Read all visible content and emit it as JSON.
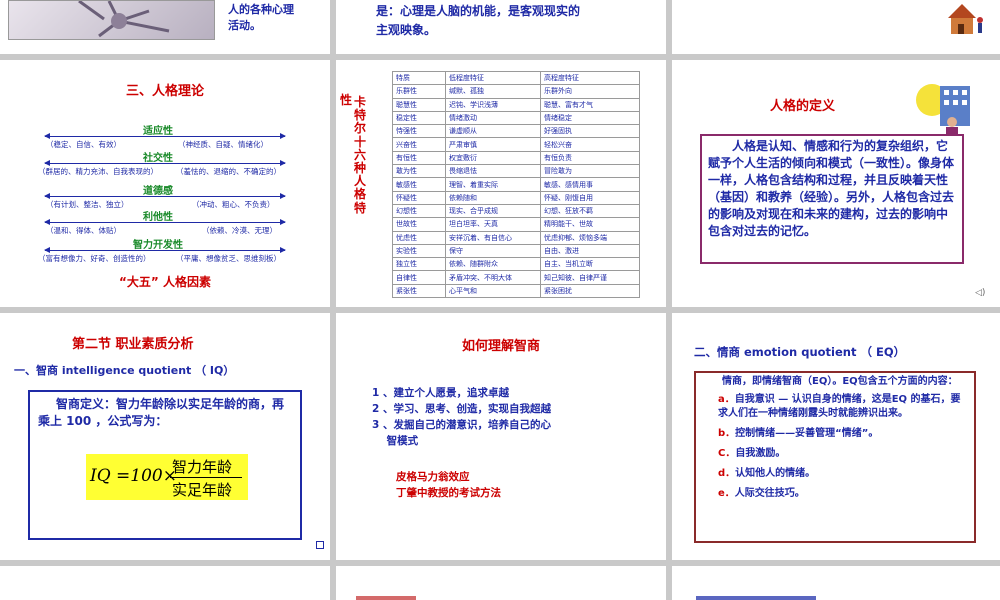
{
  "slides": {
    "s1": {
      "caption": "人的各种心理\n活动。"
    },
    "s2": {
      "text": "是：心理是人脑的机能，是客观现实的\n主观映象。"
    },
    "s4": {
      "title": "三、人格理论",
      "traits": [
        {
          "label": "适应性",
          "left": "（稳定、自信、有效）",
          "right": "（神经质、自疑、情绪化）"
        },
        {
          "label": "社交性",
          "left": "（群居的、精力充沛、自我表现的）",
          "right": "（羞怯的、退缩的、不确定的）"
        },
        {
          "label": "道德感",
          "left": "（有计划、整洁、独立）",
          "right": "（冲动、粗心、不负责）"
        },
        {
          "label": "利他性",
          "left": "（温和、得体、体贴）",
          "right": "（依赖、冷漠、无理）"
        },
        {
          "label": "智力开发性",
          "left": "（富有想像力、好奇、创造性的）",
          "right": "（平庸、想像贫乏、思维刻板）"
        }
      ],
      "footer": "“大五”  人格因素"
    },
    "s5": {
      "side_title": [
        "性",
        "卡",
        "特",
        "尔",
        "十",
        "六",
        "种",
        "人",
        "格",
        "特"
      ],
      "headers": [
        "特质",
        "低程度特征",
        "高程度特征"
      ],
      "rows": [
        [
          "乐群性",
          "缄默、孤独",
          "乐群外向"
        ],
        [
          "聪慧性",
          "迟钝、学识浅薄",
          "聪慧、富有才气"
        ],
        [
          "稳定性",
          "情绪激动",
          "情绪稳定"
        ],
        [
          "恃强性",
          "谦虚顺从",
          "好强固执"
        ],
        [
          "兴奋性",
          "严肃审慎",
          "轻松兴奋"
        ],
        [
          "有恒性",
          "权宜敷衍",
          "有恒负责"
        ],
        [
          "敢为性",
          "畏缩退怯",
          "冒险敢为"
        ],
        [
          "敏感性",
          "理智、着重实际",
          "敏感、感情用事"
        ],
        [
          "怀疑性",
          "依赖随和",
          "怀疑、刚愎自用"
        ],
        [
          "幻想性",
          "现实、合乎成规",
          "幻想、狂放不羁"
        ],
        [
          "世故性",
          "坦白坦率、天真",
          "精明能干、世故"
        ],
        [
          "忧虑性",
          "安祥沉着、有自信心",
          "忧虑抑郁、烦恼多端"
        ],
        [
          "实验性",
          "保守",
          "自由、激进"
        ],
        [
          "独立性",
          "依赖、随群附众",
          "自主、当机立断"
        ],
        [
          "自律性",
          "矛盾冲突、不明大体",
          "知己知彼、自律严谨"
        ],
        [
          "紧张性",
          "心平气和",
          "紧张困扰"
        ]
      ]
    },
    "s6": {
      "title": "人格的定义",
      "body": "人格是认知、情感和行为的复杂组织，它赋予个人生活的倾向和模式（一致性）。像身体一样，人格包含结构和过程，并且反映着天性（基因）和教养（经验）。另外，人格包含过去的影响及对现在和未来的建构，过去的影响中包含对过去的记忆。"
    },
    "s7": {
      "title": "第二节 职业素质分析",
      "subtitle": "一、智商  intelligence quotient （  IQ）",
      "definition": "智商定义：智力年龄除以实足年龄的商，再乘上 100 ，公式写为：",
      "formula_lhs": "IQ =100×",
      "formula_num": "智力年龄",
      "formula_den": "实足年龄"
    },
    "s8": {
      "title": "如何理解智商",
      "items": [
        "1 、建立个人愿景，追求卓越",
        "2 、学习、思考、创造，实现自我超越",
        "3 、发掘自己的潜意识，培养自己的心",
        "    智模式"
      ],
      "links": [
        "皮格马力翁效应",
        "丁肇中教授的考试方法"
      ]
    },
    "s9": {
      "title": "二、情商  emotion quotient （  EQ）",
      "intro": "情商，即情绪智商（EQ）。EQ包含五个方面的内容：",
      "items": [
        {
          "letter": "a．",
          "text": "自我意识 — 认识自身的情绪，这是EQ 的基石，要求人们在一种情绪刚露头时就能辨识出来。"
        },
        {
          "letter": "b．",
          "text": "控制情绪——妥善管理“情绪”。"
        },
        {
          "letter": "C．",
          "text": "自我激励。"
        },
        {
          "letter": "d．",
          "text": "认知他人的情绪。"
        },
        {
          "letter": "e．",
          "text": "人际交往技巧。"
        }
      ]
    }
  },
  "colors": {
    "navy": "#1f2aa6",
    "red": "#cc0000",
    "green": "#1a8a2a",
    "formula_bg": "#ffff33"
  }
}
